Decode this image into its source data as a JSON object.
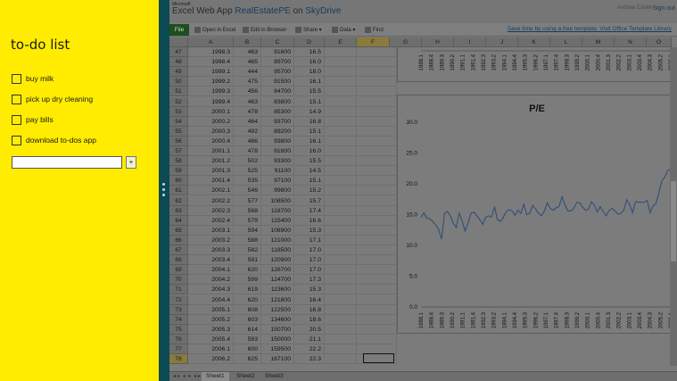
{
  "todo": {
    "title": "to-do list",
    "items": [
      {
        "label": "buy milk"
      },
      {
        "label": "pick up dry cleaning"
      },
      {
        "label": "pay bills"
      },
      {
        "label": "download to-dos app"
      }
    ],
    "input_value": "",
    "add_label": "+"
  },
  "excel": {
    "ms_label": "Microsoft",
    "app_name": "Excel Web App",
    "file_name": "RealEstatePE",
    "on": "on",
    "location": "SkyDrive",
    "user": "Andrew Estate",
    "sign_out": "Sign out",
    "ribbon": {
      "file": "File",
      "open_in_excel": "Open in Excel",
      "edit_in_browser": "Edit in Browser",
      "share": "Share ▾",
      "data": "Data ▾",
      "find": "Find",
      "promo": "Save time by using a free template. Visit Office Template Library"
    },
    "columns": [
      "A",
      "B",
      "C",
      "D",
      "E",
      "F",
      "G",
      "H",
      "I",
      "J",
      "K",
      "L",
      "M",
      "N",
      "O"
    ],
    "selected_column": "F",
    "selected_row": "78",
    "rows": [
      [
        "47",
        "1998.3",
        "463",
        "91600",
        "16.5"
      ],
      [
        "48",
        "1998.4",
        "465",
        "89700",
        "16.0"
      ],
      [
        "49",
        "1999.1",
        "444",
        "95700",
        "18.0"
      ],
      [
        "50",
        "1999.2",
        "475",
        "91500",
        "16.1"
      ],
      [
        "51",
        "1999.3",
        "456",
        "84700",
        "15.5"
      ],
      [
        "52",
        "1999.4",
        "463",
        "83800",
        "15.1"
      ],
      [
        "53",
        "2000.1",
        "478",
        "85300",
        "14.9"
      ],
      [
        "54",
        "2000.2",
        "464",
        "93700",
        "16.8"
      ],
      [
        "55",
        "2000.3",
        "492",
        "89200",
        "15.1"
      ],
      [
        "56",
        "2000.4",
        "486",
        "93800",
        "16.1"
      ],
      [
        "57",
        "2001.1",
        "478",
        "91600",
        "16.0"
      ],
      [
        "58",
        "2001.2",
        "502",
        "93300",
        "15.5"
      ],
      [
        "59",
        "2001.3",
        "525",
        "91100",
        "14.5"
      ],
      [
        "60",
        "2001.4",
        "535",
        "97100",
        "15.1"
      ],
      [
        "61",
        "2002.1",
        "546",
        "99800",
        "15.2"
      ],
      [
        "62",
        "2002.2",
        "577",
        "108500",
        "15.7"
      ],
      [
        "63",
        "2002.3",
        "568",
        "118700",
        "17.4"
      ],
      [
        "64",
        "2002.4",
        "579",
        "115400",
        "16.6"
      ],
      [
        "65",
        "2003.1",
        "594",
        "108900",
        "15.3"
      ],
      [
        "66",
        "2003.2",
        "588",
        "121000",
        "17.1"
      ],
      [
        "67",
        "2003.3",
        "582",
        "118500",
        "17.0"
      ],
      [
        "68",
        "2003.4",
        "591",
        "120900",
        "17.0"
      ],
      [
        "69",
        "2004.1",
        "620",
        "126700",
        "17.0"
      ],
      [
        "70",
        "2004.2",
        "599",
        "124700",
        "17.3"
      ],
      [
        "71",
        "2004.3",
        "619",
        "113600",
        "15.3"
      ],
      [
        "72",
        "2004.4",
        "620",
        "121800",
        "16.4"
      ],
      [
        "73",
        "2005.1",
        "608",
        "122500",
        "16.8"
      ],
      [
        "74",
        "2005.2",
        "603",
        "134600",
        "18.6"
      ],
      [
        "75",
        "2005.3",
        "614",
        "150700",
        "20.5"
      ],
      [
        "76",
        "2005.4",
        "593",
        "150000",
        "21.1"
      ],
      [
        "77",
        "2006.1",
        "600",
        "159500",
        "22.2"
      ],
      [
        "78",
        "2006.2",
        "625",
        "167100",
        "22.3"
      ]
    ],
    "top_chart_labels": [
      "1988.1",
      "1988.4",
      "1989.3",
      "1990.2",
      "1991.1",
      "1991.4",
      "1992.3",
      "1993.2",
      "1994.1",
      "1994.4",
      "1995.3",
      "1996.2",
      "1997.1",
      "1997.4",
      "1998.3",
      "1999.2",
      "2000.1",
      "2000.4",
      "2001.3",
      "2002.2",
      "2003.1",
      "2003.4",
      "2004.3",
      "2005.2",
      "2006.1"
    ],
    "sheets": [
      "Sheet1",
      "Sheet2",
      "Sheet3"
    ],
    "active_sheet": "Sheet1",
    "colors": {
      "todo_bg": "#ffec00",
      "splitter": "#0b4a55",
      "dim": "#7b7b7b"
    }
  },
  "chart_data": {
    "type": "line",
    "title": "P/E",
    "ylim": [
      0,
      30
    ],
    "yticks": [
      "0.0",
      "5.0",
      "10.0",
      "15.0",
      "20.0",
      "25.0",
      "30.0"
    ],
    "x": [
      "1988.1",
      "1988.4",
      "1989.3",
      "1990.2",
      "1991.1",
      "1991.4",
      "1992.3",
      "1993.2",
      "1994.1",
      "1994.4",
      "1995.3",
      "1996.2",
      "1997.1",
      "1997.4",
      "1998.3",
      "1999.2",
      "2000.1",
      "2000.4",
      "2001.3",
      "2002.2",
      "2003.1",
      "2003.4",
      "2004.3",
      "2005.2",
      "2006.1"
    ],
    "series": [
      {
        "values": [
          14.5,
          15.3,
          14.4,
          14.3,
          13.9,
          13.3,
          12.6,
          11.0,
          15.2,
          15.5,
          14.8,
          13.6,
          12.9,
          15.2,
          14.0,
          12.3,
          13.6,
          15.2,
          15.4,
          14.8,
          14.2,
          13.4,
          14.6,
          14.8,
          14.6,
          16.3,
          14.2,
          13.9,
          14.5,
          15.5,
          15.8,
          15.6,
          14.9,
          15.7,
          15.2,
          16.7,
          15.0,
          15.2,
          16.5,
          15.9,
          15.2,
          14.8,
          15.6,
          16.9,
          16.0,
          15.7,
          16.1,
          16.3,
          17.9,
          16.6,
          15.6,
          15.6,
          16.0,
          17.0,
          16.9,
          16.2,
          15.7,
          15.9,
          17.1,
          16.5,
          15.4,
          16.3,
          15.5,
          14.8,
          15.7,
          16.0,
          15.6,
          15.1,
          15.2,
          15.7,
          17.4,
          16.6,
          15.3,
          17.1,
          17.0,
          17.0,
          17.0,
          17.3,
          15.3,
          16.4,
          16.8,
          18.6,
          20.5,
          21.1,
          22.2,
          22.3
        ]
      }
    ],
    "grid": false,
    "legend": "none"
  }
}
